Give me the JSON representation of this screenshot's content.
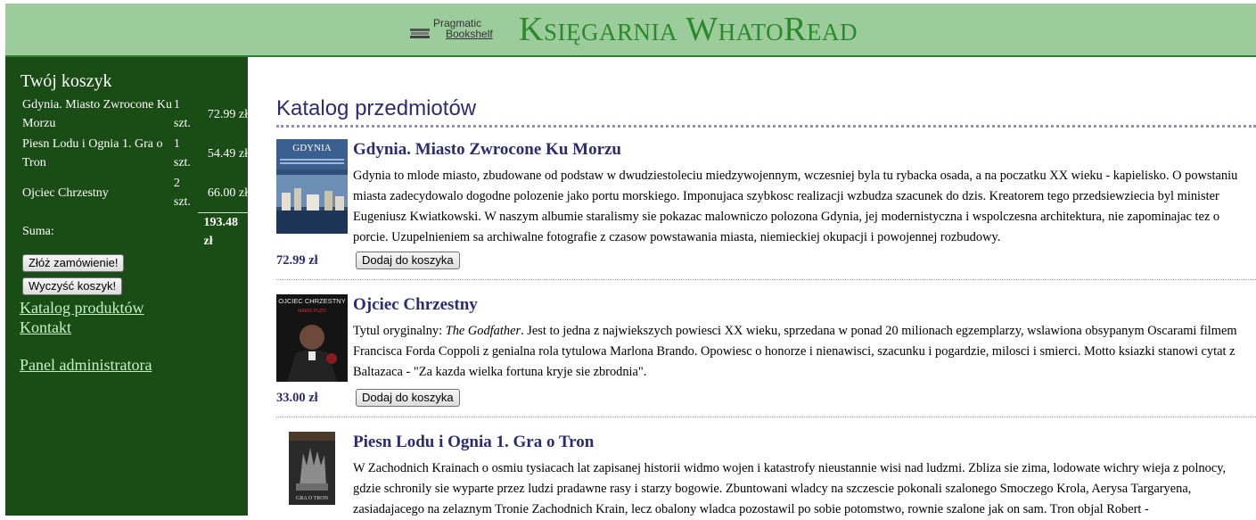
{
  "header": {
    "logo_line1": "Pragmatic",
    "logo_line2": "Bookshelf",
    "store_title": "Księgarnia WhatoRead"
  },
  "sidebar": {
    "cart_title": "Twój koszyk",
    "cart_items": [
      {
        "name": "Gdynia. Miasto Zwrocone Ku Morzu",
        "qty": "1 szt.",
        "price": "72.99 zł"
      },
      {
        "name": "Piesn Lodu i Ognia 1. Gra o Tron",
        "qty": "1 szt.",
        "price": "54.49 zł"
      },
      {
        "name": "Ojciec Chrzestny",
        "qty": "2 szt.",
        "price": "66.00 zł"
      }
    ],
    "sum_label": "Suma:",
    "sum_value": "193.48 zł",
    "order_button": "Złóż zamówienie!",
    "clear_button": "Wyczyść koszyk!",
    "links": [
      "Katalog produktów",
      "Kontakt",
      "Panel administratora"
    ]
  },
  "main": {
    "catalog_title": "Katalog przedmiotów",
    "add_button": "Dodaj do koszyka",
    "products": [
      {
        "title": "Gdynia. Miasto Zwrocone Ku Morzu",
        "description": "Gdynia to mlode miasto, zbudowane od podstaw w dwudziestoleciu miedzywojennym, wczesniej byla tu rybacka osada, a na poczatku XX wieku - kapielisko. O powstaniu miasta zadecydowalo dogodne polozenie jako portu morskiego. Imponujaca szybkosc realizacji wzbudza szacunek do dzis. Kreatorem tego przedsiewziecia byl minister Eugeniusz Kwiatkowski. W naszym albumie staralismy sie pokazac malowniczo polozona Gdynia, jej modernistyczna i wspolczesna architektura, nie zapominajac tez o porcie. Uzupelnieniem sa archiwalne fotografie z czasow powstawania miasta, niemieckiej okupacji i powojennej rozbudowy.",
        "price": "72.99 zł",
        "cover_text": "GDYNIA"
      },
      {
        "title": "Ojciec Chrzestny",
        "description_prefix": "Tytul oryginalny: ",
        "description_original_title": "The Godfather",
        "description": ". Jest to jedna z najwiekszych powiesci XX wieku, sprzedana w ponad 20 milionach egzemplarzy, wslawiona obsypanym Oscarami filmem Francisca Forda Coppoli z genialna rola tytulowa Marlona Brando. Opowiesc o honorze i nienawisci, szacunku i pogardzie, milosci i smierci. Motto ksiazki stanowi cytat z Baltazaca - \"Za kazda wielka fortuna kryje sie zbrodnia\".",
        "price": "33.00 zł",
        "cover_text": "OJCIEC CHRZESTNY",
        "cover_author": "MARIO PUZO"
      },
      {
        "title": "Piesn Lodu i Ognia 1. Gra o Tron",
        "description": "W Zachodnich Krainach o osmiu tysiacach lat zapisanej historii widmo wojen i katastrofy nieustannie wisi nad ludzmi. Zbliza sie zima, lodowate wichry wieja z polnocy, gdzie schronily sie wyparte przez ludzi pradawne rasy i starzy bogowie. Zbuntowani wladcy na szczescie pokonali szalonego Smoczego Krola, Aerysa Targaryena, zasiadajacego na zelaznym Tronie Zachodnich Krain, lecz obalony wladca pozostawil po sobie potomstwo, rownie szalone jak on sam. Tron objal Robert -",
        "cover_text": "GRA O TRON"
      }
    ]
  },
  "colors": {
    "banner": "#9ccb9c",
    "sidebar": "#1a4c15",
    "title_green": "#2a8a2a",
    "navy": "#2b2b73",
    "link": "#c8f0c8"
  }
}
